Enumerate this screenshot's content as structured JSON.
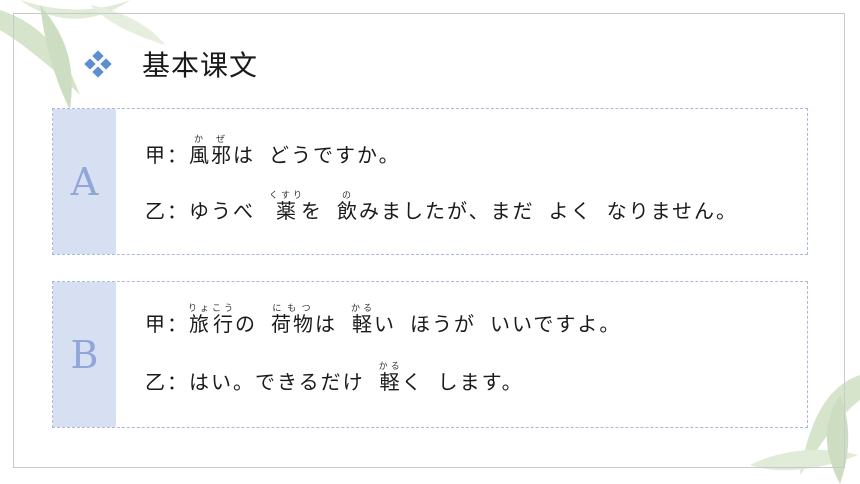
{
  "title": "基本课文",
  "icons": {
    "title": "diamond-cluster-icon",
    "decoration": "bamboo-leaf-icon"
  },
  "colors": {
    "accent": "#d7e0f3",
    "label_text": "#8fa6d6",
    "diamond": "#5b8fd0",
    "border": "#a9b8dc"
  },
  "cards": [
    {
      "label": "A",
      "lines": [
        {
          "speaker": "甲：",
          "segments": [
            {
              "base": "風邪",
              "ruby": "かぜ"
            },
            {
              "text": "は"
            },
            {
              "gap": true
            },
            {
              "text": "どうですか。"
            }
          ]
        },
        {
          "speaker": "乙：",
          "segments": [
            {
              "text": "ゆうべ"
            },
            {
              "gap": true
            },
            {
              "base": "薬",
              "ruby": "くすり"
            },
            {
              "text": "を"
            },
            {
              "gap": true
            },
            {
              "base": "飲",
              "ruby": "の"
            },
            {
              "text": "みましたが、まだ"
            },
            {
              "gap": true
            },
            {
              "text": "よく"
            },
            {
              "gap": true
            },
            {
              "text": "なりません。"
            }
          ]
        }
      ]
    },
    {
      "label": "B",
      "lines": [
        {
          "speaker": "甲：",
          "segments": [
            {
              "base": "旅行",
              "ruby": "りょこう"
            },
            {
              "text": "の"
            },
            {
              "gap": true
            },
            {
              "base": "荷物",
              "ruby": "にもつ"
            },
            {
              "text": "は"
            },
            {
              "gap": true
            },
            {
              "base": "軽",
              "ruby": "かる"
            },
            {
              "text": "い"
            },
            {
              "gap": true
            },
            {
              "text": "ほうが"
            },
            {
              "gap": true
            },
            {
              "text": "いいですよ。"
            }
          ]
        },
        {
          "speaker": "乙：",
          "segments": [
            {
              "text": "はい。できるだけ"
            },
            {
              "gap": true
            },
            {
              "base": "軽",
              "ruby": "かる"
            },
            {
              "text": "く"
            },
            {
              "gap": true
            },
            {
              "text": "します。"
            }
          ]
        }
      ]
    }
  ]
}
